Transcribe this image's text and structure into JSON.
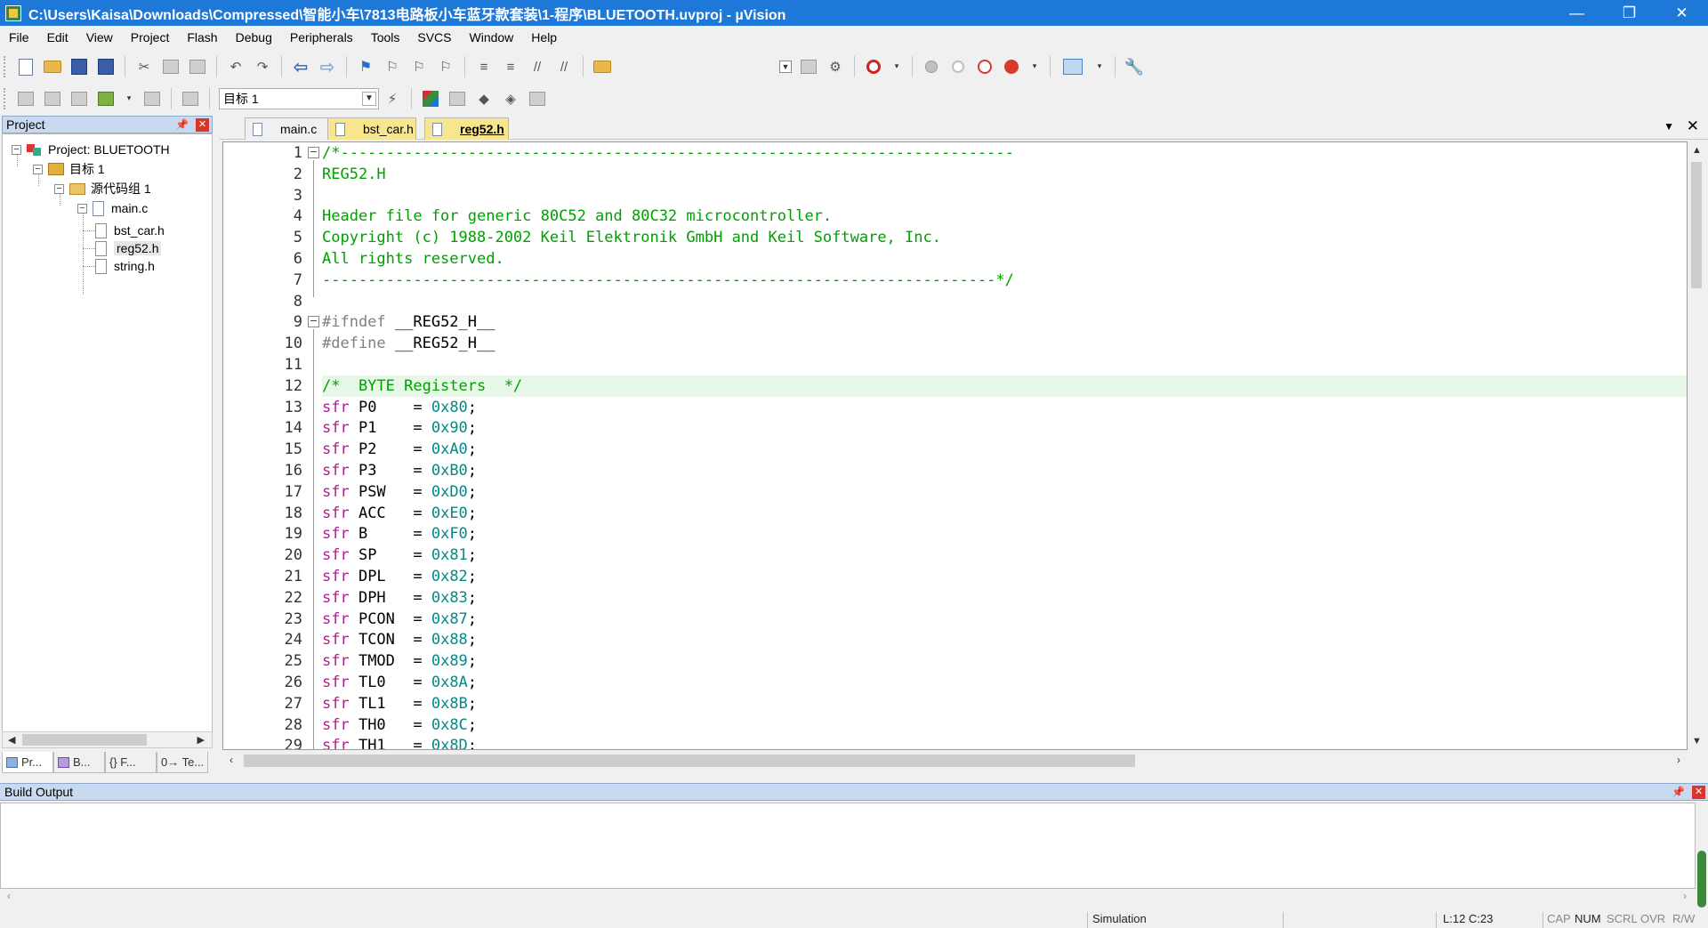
{
  "window": {
    "title": "C:\\Users\\Kaisa\\Downloads\\Compressed\\智能小车\\7813电路板小车蓝牙款套装\\1-程序\\BLUETOOTH.uvproj - µVision",
    "controls": {
      "minimize": "—",
      "restore": "❐",
      "close": "✕"
    }
  },
  "menu": [
    "File",
    "Edit",
    "View",
    "Project",
    "Flash",
    "Debug",
    "Peripherals",
    "Tools",
    "SVCS",
    "Window",
    "Help"
  ],
  "toolbar2": {
    "target": "目标 1"
  },
  "project_panel": {
    "title": "Project",
    "tree": {
      "project": "Project: BLUETOOTH",
      "target": "目标 1",
      "group": "源代码组 1",
      "files": [
        "main.c",
        "bst_car.h",
        "reg52.h",
        "string.h"
      ]
    },
    "tabs": [
      "Pr...",
      "B...",
      "{} F...",
      "0→ Te..."
    ]
  },
  "editor": {
    "tabs": [
      "main.c",
      "bst_car.h",
      "reg52.h"
    ],
    "active_tab": "reg52.h",
    "lines": [
      "/*--------------------------------------------------------------------------",
      "REG52.H",
      "",
      "Header file for generic 80C52 and 80C32 microcontroller.",
      "Copyright (c) 1988-2002 Keil Elektronik GmbH and Keil Software, Inc.",
      "All rights reserved.",
      "--------------------------------------------------------------------------*/",
      "",
      "#ifndef __REG52_H__",
      "#define __REG52_H__",
      "",
      "/*  BYTE Registers  */",
      "sfr P0    = 0x80;",
      "sfr P1    = 0x90;",
      "sfr P2    = 0xA0;",
      "sfr P3    = 0xB0;",
      "sfr PSW   = 0xD0;",
      "sfr ACC   = 0xE0;",
      "sfr B     = 0xF0;",
      "sfr SP    = 0x81;",
      "sfr DPL   = 0x82;",
      "sfr DPH   = 0x83;",
      "sfr PCON  = 0x87;",
      "sfr TCON  = 0x88;",
      "sfr TMOD  = 0x89;",
      "sfr TL0   = 0x8A;",
      "sfr TL1   = 0x8B;",
      "sfr TH0   = 0x8C;",
      "sfr TH1   = 0x8D;"
    ],
    "highlight_line": 12
  },
  "build_output": {
    "title": "Build Output"
  },
  "status": {
    "mode": "Simulation",
    "position": "L:12 C:23",
    "indicators": [
      "CAP",
      "NUM",
      "SCRL",
      "OVR",
      "R/W"
    ]
  },
  "colors": {
    "titlebar": "#1e78d7",
    "comment": "#00a000",
    "keyword": "#b51a8f",
    "number": "#008a8a",
    "preprocessor": "#808080",
    "highlight": "#e8f8e8",
    "tab_active": "#f7e58f"
  }
}
